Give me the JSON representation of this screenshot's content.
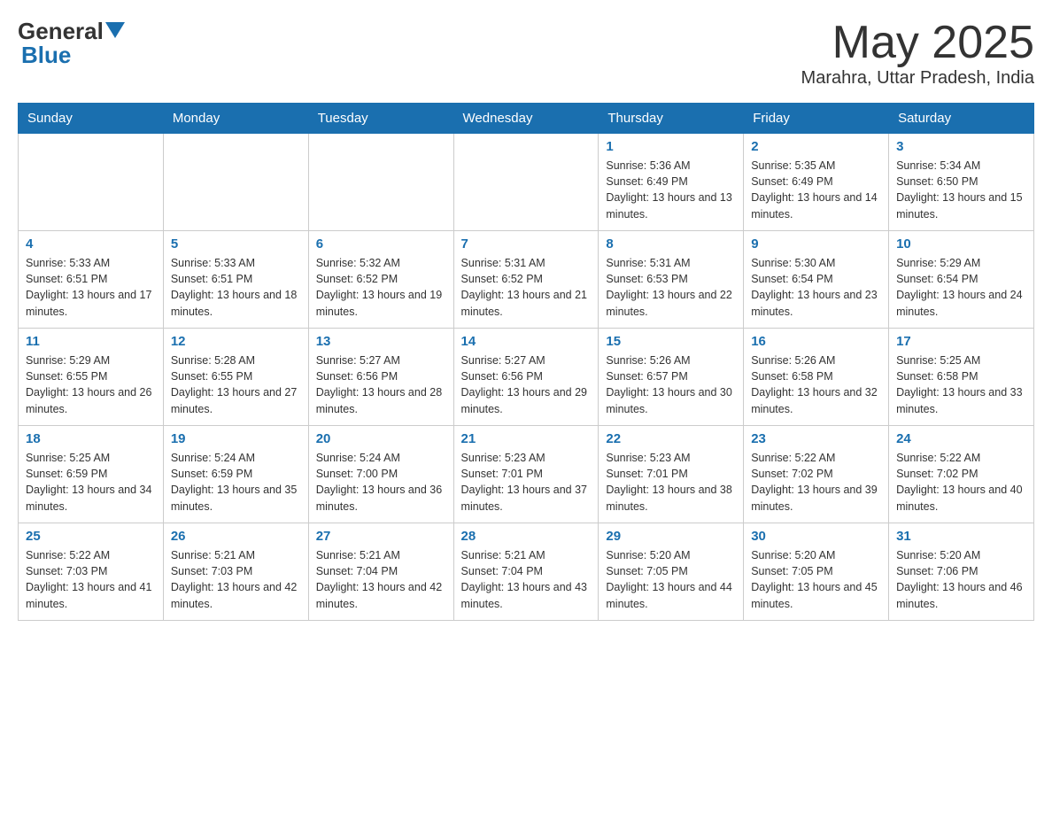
{
  "logo": {
    "general": "General",
    "blue": "Blue",
    "arrow": "▼"
  },
  "title": "May 2025",
  "subtitle": "Marahra, Uttar Pradesh, India",
  "days_of_week": [
    "Sunday",
    "Monday",
    "Tuesday",
    "Wednesday",
    "Thursday",
    "Friday",
    "Saturday"
  ],
  "weeks": [
    [
      {
        "day": "",
        "info": ""
      },
      {
        "day": "",
        "info": ""
      },
      {
        "day": "",
        "info": ""
      },
      {
        "day": "",
        "info": ""
      },
      {
        "day": "1",
        "info": "Sunrise: 5:36 AM\nSunset: 6:49 PM\nDaylight: 13 hours and 13 minutes."
      },
      {
        "day": "2",
        "info": "Sunrise: 5:35 AM\nSunset: 6:49 PM\nDaylight: 13 hours and 14 minutes."
      },
      {
        "day": "3",
        "info": "Sunrise: 5:34 AM\nSunset: 6:50 PM\nDaylight: 13 hours and 15 minutes."
      }
    ],
    [
      {
        "day": "4",
        "info": "Sunrise: 5:33 AM\nSunset: 6:51 PM\nDaylight: 13 hours and 17 minutes."
      },
      {
        "day": "5",
        "info": "Sunrise: 5:33 AM\nSunset: 6:51 PM\nDaylight: 13 hours and 18 minutes."
      },
      {
        "day": "6",
        "info": "Sunrise: 5:32 AM\nSunset: 6:52 PM\nDaylight: 13 hours and 19 minutes."
      },
      {
        "day": "7",
        "info": "Sunrise: 5:31 AM\nSunset: 6:52 PM\nDaylight: 13 hours and 21 minutes."
      },
      {
        "day": "8",
        "info": "Sunrise: 5:31 AM\nSunset: 6:53 PM\nDaylight: 13 hours and 22 minutes."
      },
      {
        "day": "9",
        "info": "Sunrise: 5:30 AM\nSunset: 6:54 PM\nDaylight: 13 hours and 23 minutes."
      },
      {
        "day": "10",
        "info": "Sunrise: 5:29 AM\nSunset: 6:54 PM\nDaylight: 13 hours and 24 minutes."
      }
    ],
    [
      {
        "day": "11",
        "info": "Sunrise: 5:29 AM\nSunset: 6:55 PM\nDaylight: 13 hours and 26 minutes."
      },
      {
        "day": "12",
        "info": "Sunrise: 5:28 AM\nSunset: 6:55 PM\nDaylight: 13 hours and 27 minutes."
      },
      {
        "day": "13",
        "info": "Sunrise: 5:27 AM\nSunset: 6:56 PM\nDaylight: 13 hours and 28 minutes."
      },
      {
        "day": "14",
        "info": "Sunrise: 5:27 AM\nSunset: 6:56 PM\nDaylight: 13 hours and 29 minutes."
      },
      {
        "day": "15",
        "info": "Sunrise: 5:26 AM\nSunset: 6:57 PM\nDaylight: 13 hours and 30 minutes."
      },
      {
        "day": "16",
        "info": "Sunrise: 5:26 AM\nSunset: 6:58 PM\nDaylight: 13 hours and 32 minutes."
      },
      {
        "day": "17",
        "info": "Sunrise: 5:25 AM\nSunset: 6:58 PM\nDaylight: 13 hours and 33 minutes."
      }
    ],
    [
      {
        "day": "18",
        "info": "Sunrise: 5:25 AM\nSunset: 6:59 PM\nDaylight: 13 hours and 34 minutes."
      },
      {
        "day": "19",
        "info": "Sunrise: 5:24 AM\nSunset: 6:59 PM\nDaylight: 13 hours and 35 minutes."
      },
      {
        "day": "20",
        "info": "Sunrise: 5:24 AM\nSunset: 7:00 PM\nDaylight: 13 hours and 36 minutes."
      },
      {
        "day": "21",
        "info": "Sunrise: 5:23 AM\nSunset: 7:01 PM\nDaylight: 13 hours and 37 minutes."
      },
      {
        "day": "22",
        "info": "Sunrise: 5:23 AM\nSunset: 7:01 PM\nDaylight: 13 hours and 38 minutes."
      },
      {
        "day": "23",
        "info": "Sunrise: 5:22 AM\nSunset: 7:02 PM\nDaylight: 13 hours and 39 minutes."
      },
      {
        "day": "24",
        "info": "Sunrise: 5:22 AM\nSunset: 7:02 PM\nDaylight: 13 hours and 40 minutes."
      }
    ],
    [
      {
        "day": "25",
        "info": "Sunrise: 5:22 AM\nSunset: 7:03 PM\nDaylight: 13 hours and 41 minutes."
      },
      {
        "day": "26",
        "info": "Sunrise: 5:21 AM\nSunset: 7:03 PM\nDaylight: 13 hours and 42 minutes."
      },
      {
        "day": "27",
        "info": "Sunrise: 5:21 AM\nSunset: 7:04 PM\nDaylight: 13 hours and 42 minutes."
      },
      {
        "day": "28",
        "info": "Sunrise: 5:21 AM\nSunset: 7:04 PM\nDaylight: 13 hours and 43 minutes."
      },
      {
        "day": "29",
        "info": "Sunrise: 5:20 AM\nSunset: 7:05 PM\nDaylight: 13 hours and 44 minutes."
      },
      {
        "day": "30",
        "info": "Sunrise: 5:20 AM\nSunset: 7:05 PM\nDaylight: 13 hours and 45 minutes."
      },
      {
        "day": "31",
        "info": "Sunrise: 5:20 AM\nSunset: 7:06 PM\nDaylight: 13 hours and 46 minutes."
      }
    ]
  ]
}
